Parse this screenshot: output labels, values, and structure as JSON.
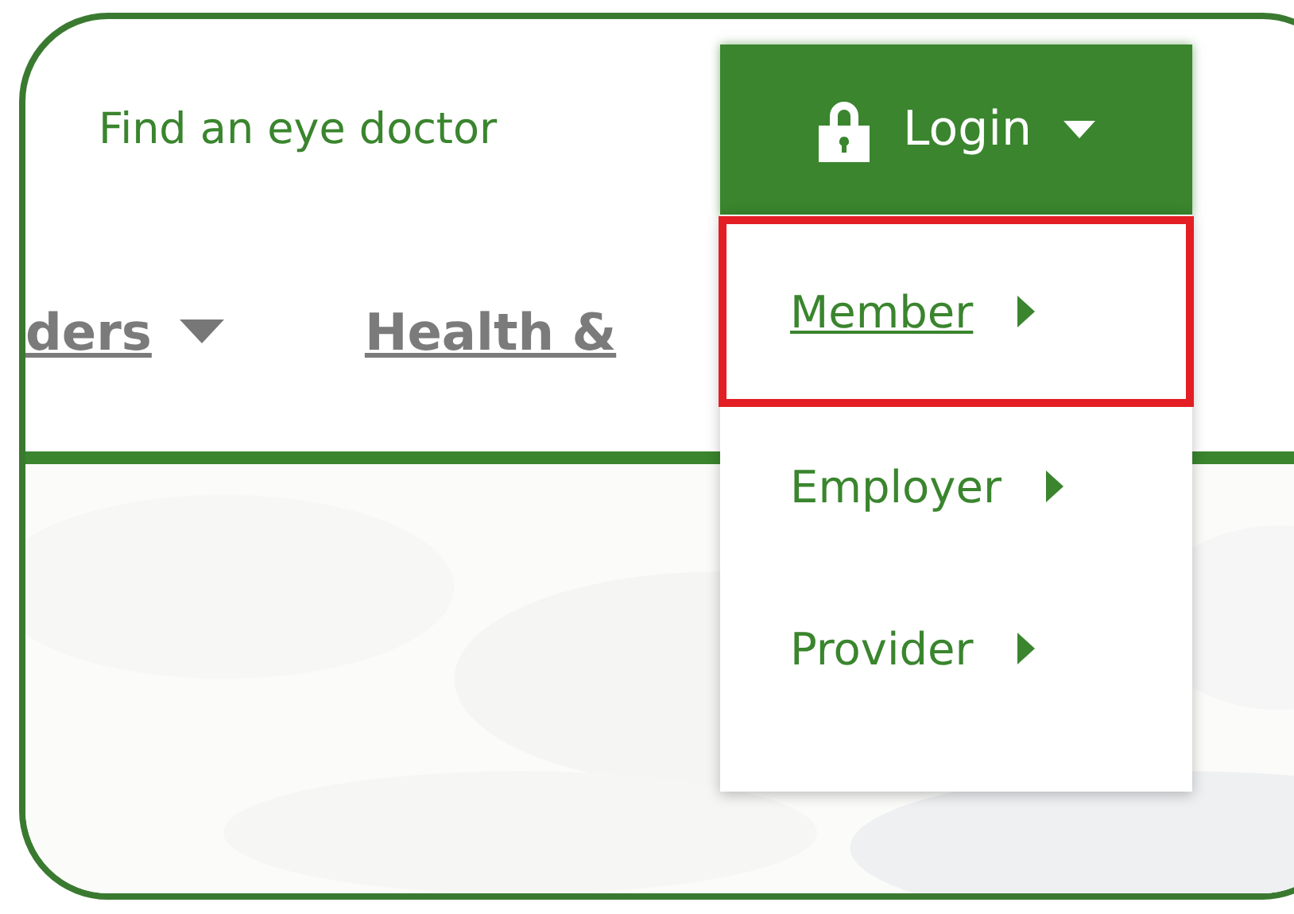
{
  "top_bar": {
    "link": "Find an eye doctor",
    "login_button": {
      "label": "Login",
      "expanded": true
    }
  },
  "nav": [
    {
      "label": "ders",
      "has_menu": true
    },
    {
      "label": "Health &",
      "has_menu": false
    }
  ],
  "login_menu": [
    {
      "label": "Member",
      "selected": true,
      "highlighted": true
    },
    {
      "label": "Employer",
      "selected": false,
      "highlighted": false
    },
    {
      "label": "Provider",
      "selected": false,
      "highlighted": false
    }
  ]
}
